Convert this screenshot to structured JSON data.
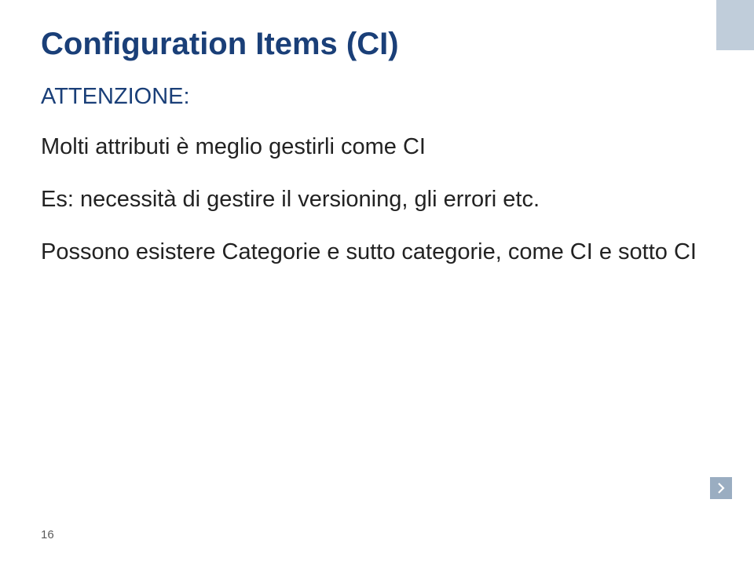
{
  "title": "Configuration Items (CI)",
  "subtitle": "ATTENZIONE:",
  "body": {
    "line1": "Molti attributi è meglio gestirli come CI",
    "line2": "Es: necessità di gestire il versioning, gli errori etc.",
    "line3": "Possono esistere Categorie e sutto categorie, come CI e sotto CI"
  },
  "page_number": "16",
  "colors": {
    "heading": "#1a3f78",
    "accent_block": "#c0cdda",
    "chevron_bg": "#9aadc1"
  }
}
